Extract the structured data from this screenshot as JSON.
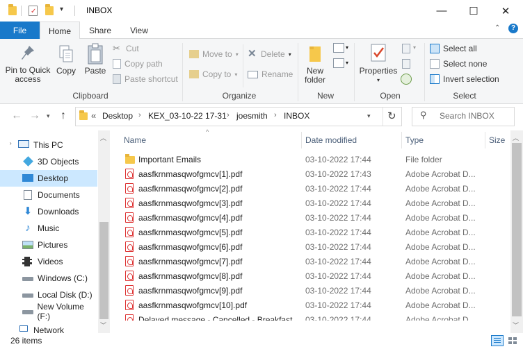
{
  "window": {
    "title": "INBOX",
    "controls": {
      "minimize": "—",
      "maximize": "☐",
      "close": "✕"
    }
  },
  "ribbon_tabs": {
    "file": "File",
    "home": "Home",
    "share": "Share",
    "view": "View"
  },
  "ribbon": {
    "clipboard": {
      "pin": "Pin to Quick access",
      "pin_l1": "Pin to Quick",
      "pin_l2": "access",
      "copy": "Copy",
      "paste": "Paste",
      "cut": "Cut",
      "copy_path": "Copy path",
      "paste_shortcut": "Paste shortcut",
      "label": "Clipboard"
    },
    "organize": {
      "move_to": "Move to",
      "copy_to": "Copy to",
      "delete": "Delete",
      "rename": "Rename",
      "label": "Organize"
    },
    "new": {
      "new_folder_l1": "New",
      "new_folder_l2": "folder",
      "label": "New"
    },
    "open": {
      "properties": "Properties",
      "label": "Open"
    },
    "select": {
      "select_all": "Select all",
      "select_none": "Select none",
      "invert": "Invert selection",
      "label": "Select"
    }
  },
  "address": {
    "overflow": "«",
    "crumbs": [
      "Desktop",
      "KEX_03-10-22 17-31",
      "joesmith",
      "INBOX"
    ],
    "search_placeholder": "Search INBOX"
  },
  "nav": {
    "items": [
      {
        "label": "This PC",
        "icon": "monitor-icon"
      },
      {
        "label": "3D Objects",
        "icon": "cube-icon"
      },
      {
        "label": "Desktop",
        "icon": "desktop-icon"
      },
      {
        "label": "Documents",
        "icon": "documents-icon"
      },
      {
        "label": "Downloads",
        "icon": "download-arrow-icon"
      },
      {
        "label": "Music",
        "icon": "music-note-icon"
      },
      {
        "label": "Pictures",
        "icon": "pictures-icon"
      },
      {
        "label": "Videos",
        "icon": "film-icon"
      },
      {
        "label": "Windows (C:)",
        "icon": "drive-icon"
      },
      {
        "label": "Local Disk (D:)",
        "icon": "drive-icon"
      },
      {
        "label": "New Volume (F:)",
        "icon": "drive-icon"
      },
      {
        "label": "Network",
        "icon": "network-icon"
      }
    ]
  },
  "columns": {
    "name": "Name",
    "date": "Date modified",
    "type": "Type",
    "size": "Size"
  },
  "files": [
    {
      "name": "Important Emails",
      "date": "03-10-2022 17:44",
      "type": "File folder",
      "kind": "folder"
    },
    {
      "name": "aasfkrnmasqwofgmcv[1].pdf",
      "date": "03-10-2022 17:43",
      "type": "Adobe Acrobat D...",
      "kind": "pdf"
    },
    {
      "name": "aasfkrnmasqwofgmcv[2].pdf",
      "date": "03-10-2022 17:44",
      "type": "Adobe Acrobat D...",
      "kind": "pdf"
    },
    {
      "name": "aasfkrnmasqwofgmcv[3].pdf",
      "date": "03-10-2022 17:44",
      "type": "Adobe Acrobat D...",
      "kind": "pdf"
    },
    {
      "name": "aasfkrnmasqwofgmcv[4].pdf",
      "date": "03-10-2022 17:44",
      "type": "Adobe Acrobat D...",
      "kind": "pdf"
    },
    {
      "name": "aasfkrnmasqwofgmcv[5].pdf",
      "date": "03-10-2022 17:44",
      "type": "Adobe Acrobat D...",
      "kind": "pdf"
    },
    {
      "name": "aasfkrnmasqwofgmcv[6].pdf",
      "date": "03-10-2022 17:44",
      "type": "Adobe Acrobat D...",
      "kind": "pdf"
    },
    {
      "name": "aasfkrnmasqwofgmcv[7].pdf",
      "date": "03-10-2022 17:44",
      "type": "Adobe Acrobat D...",
      "kind": "pdf"
    },
    {
      "name": "aasfkrnmasqwofgmcv[8].pdf",
      "date": "03-10-2022 17:44",
      "type": "Adobe Acrobat D...",
      "kind": "pdf"
    },
    {
      "name": "aasfkrnmasqwofgmcv[9].pdf",
      "date": "03-10-2022 17:44",
      "type": "Adobe Acrobat D...",
      "kind": "pdf"
    },
    {
      "name": "aasfkrnmasqwofgmcv[10].pdf",
      "date": "03-10-2022 17:44",
      "type": "Adobe Acrobat D...",
      "kind": "pdf"
    },
    {
      "name": "Delayed message - Cancelled - Breakfast...",
      "date": "03-10-2022 17:44",
      "type": "Adobe Acrobat D...",
      "kind": "pdf"
    }
  ],
  "status": {
    "count": "26 items"
  },
  "colors": {
    "accent": "#1979ca",
    "selection": "#cce8ff",
    "folder": "#f6c84b",
    "pdf": "#d33333"
  }
}
